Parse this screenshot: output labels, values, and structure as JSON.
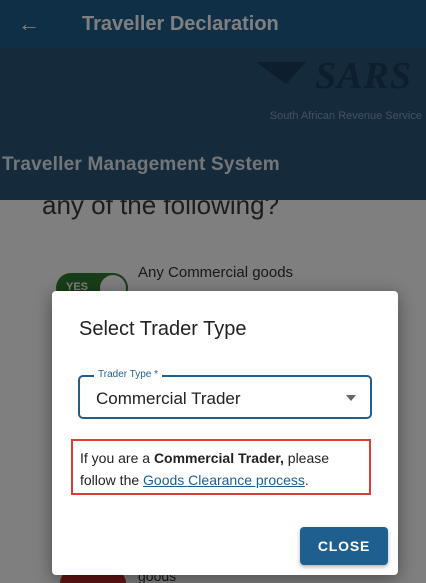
{
  "appbar": {
    "back_icon": "arrow-left-icon",
    "title": "Traveller Declaration"
  },
  "banner": {
    "logo_text": "SARS",
    "subtitle": "South African Revenue Service",
    "system_name": "Traveller Management System"
  },
  "background": {
    "question": "any of the following?",
    "toggle_label": "YES",
    "item_label": "Any Commercial goods",
    "bottom_label": "goods"
  },
  "dialog": {
    "title": "Select Trader Type",
    "field_label": "Trader Type *",
    "field_value": "Commercial Trader",
    "notice_prefix": "If you are a ",
    "notice_bold": "Commercial Trader,",
    "notice_mid": " please follow the ",
    "notice_link": "Goods Clearance process",
    "notice_suffix": ".",
    "close_label": "CLOSE"
  },
  "colors": {
    "primary": "#1f5f8f",
    "banner": "#2b5477",
    "toggle_on": "#2e7d32",
    "highlight_border": "#e53935"
  }
}
